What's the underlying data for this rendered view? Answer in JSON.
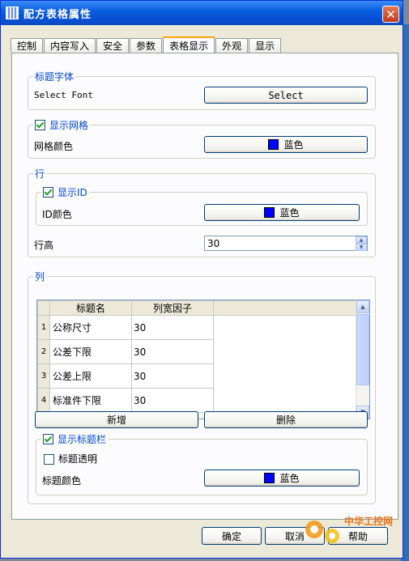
{
  "window": {
    "title": "配方表格属性"
  },
  "tabs": [
    "控制",
    "内容写入",
    "安全",
    "参数",
    "表格显示",
    "外观",
    "显示"
  ],
  "active_tab": 4,
  "title_font": {
    "legend": "标题字体",
    "label": "Select Font",
    "button": "Select"
  },
  "grid_section": {
    "legend": "显示网格",
    "checked": true,
    "color_label": "网格颜色",
    "color_button": "蓝色"
  },
  "row_section": {
    "legend": "行",
    "id_group": {
      "legend": "显示ID",
      "checked": true,
      "color_label": "ID颜色",
      "color_button": "蓝色"
    },
    "height_label": "行高",
    "height_value": "30"
  },
  "column_section": {
    "legend": "列",
    "headers": [
      "标题名",
      "列宽因子"
    ],
    "rows": [
      {
        "index": "1",
        "name": "公称尺寸",
        "width": "30"
      },
      {
        "index": "2",
        "name": "公差下限",
        "width": "30"
      },
      {
        "index": "3",
        "name": "公差上限",
        "width": "30"
      },
      {
        "index": "4",
        "name": "标准件下限",
        "width": "30"
      }
    ],
    "add_button": "新增",
    "delete_button": "删除",
    "title_bar_group": {
      "legend": "显示标题栏",
      "checked": true,
      "transparent_label": "标题透明",
      "transparent_checked": false,
      "color_label": "标题颜色",
      "color_button": "蓝色"
    }
  },
  "footer": {
    "ok": "确定",
    "cancel": "取消",
    "help": "帮助"
  },
  "swatch_color": "#0000ff",
  "watermark": "中华工控网"
}
